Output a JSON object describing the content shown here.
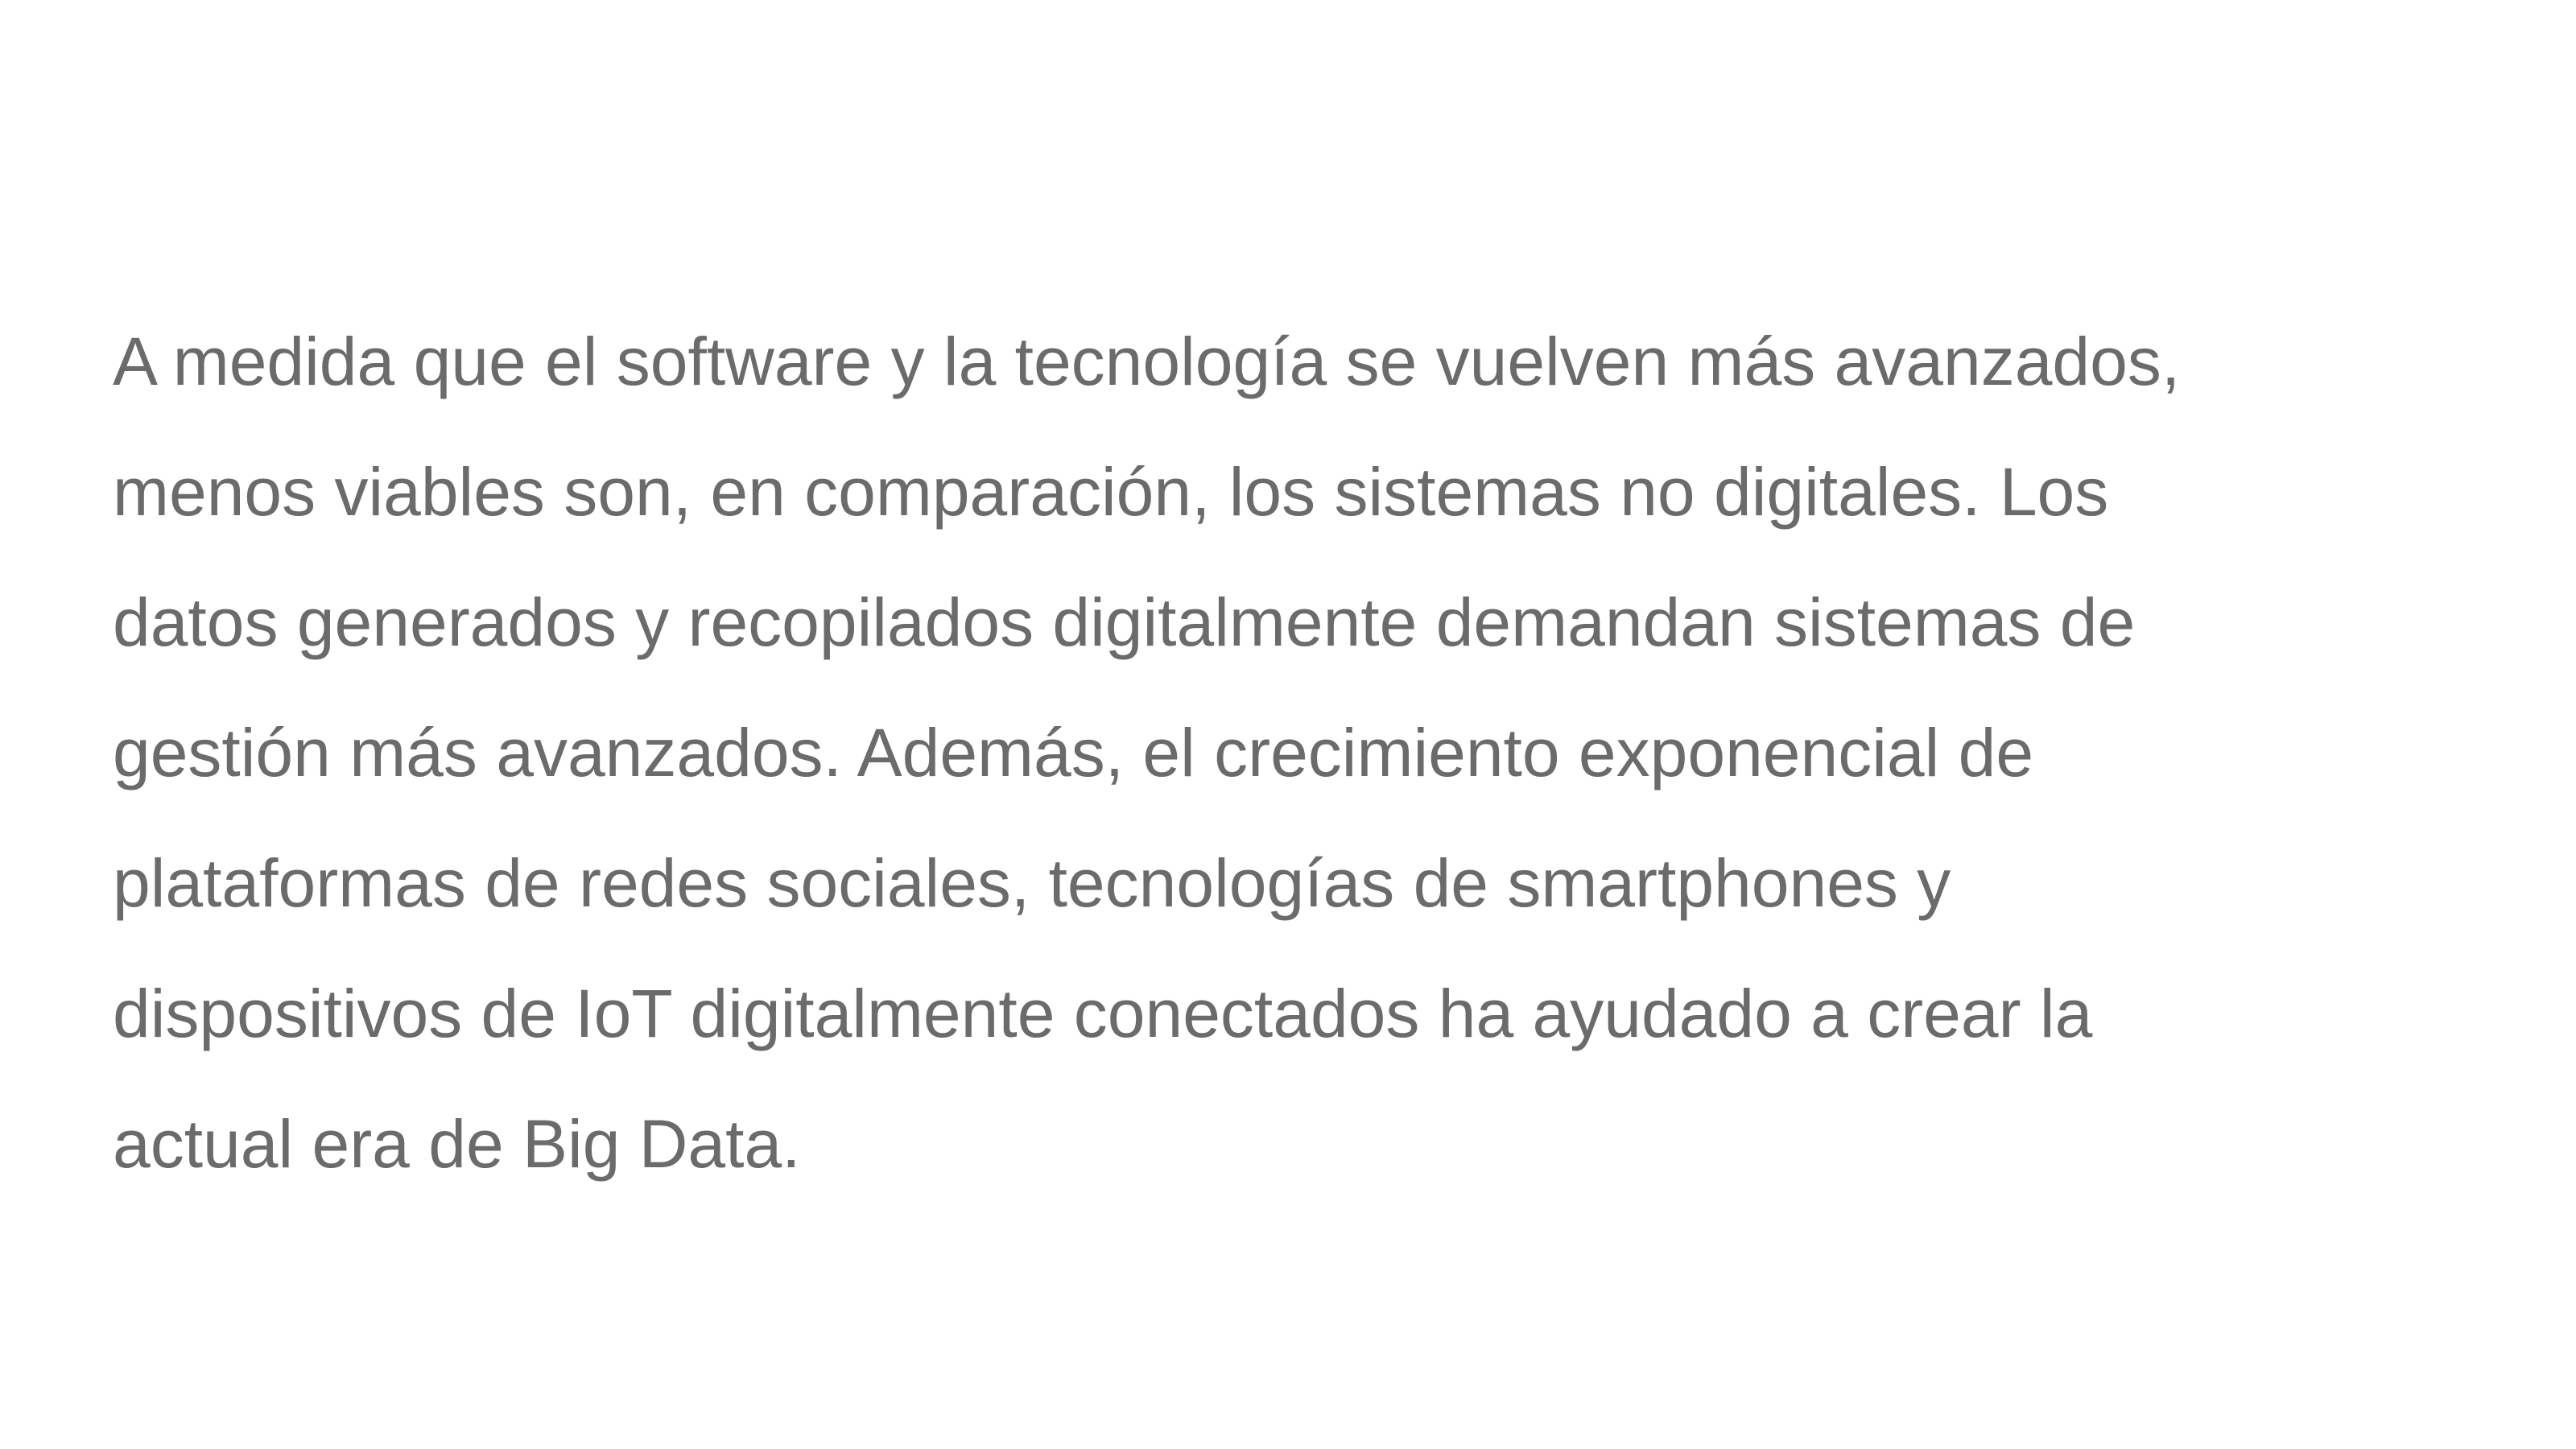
{
  "content": {
    "lines": [
      "A medida que el software y la tecnología se vuelven más avanzados,",
      "menos viables son, en comparación, los sistemas no digitales. Los",
      "datos generados y recopilados digitalmente demandan sistemas de",
      "gestión más avanzados. Además, el crecimiento exponencial de",
      "plataformas de redes sociales, tecnologías de smartphones y",
      "dispositivos de IoT digitalmente conectados ha ayudado a crear la",
      "actual era de Big Data."
    ]
  },
  "colors": {
    "text": "#6b6b6b",
    "background": "#ffffff"
  }
}
